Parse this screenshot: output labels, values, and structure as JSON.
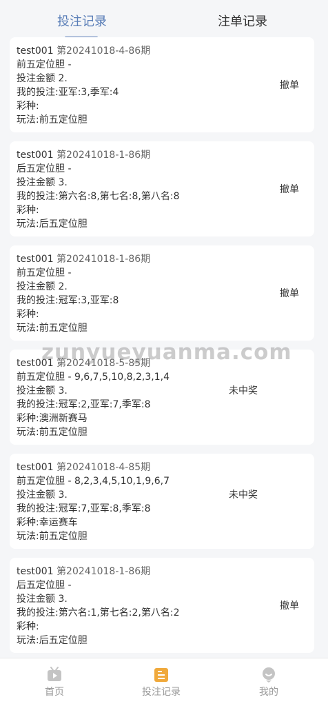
{
  "tabs": {
    "bets": "投注记录",
    "orders": "注单记录"
  },
  "records": [
    {
      "user": "test001",
      "issue": "第20241018-4-86期",
      "numbers_line": "前五定位胆 -",
      "amount": "投注金额 2.",
      "my_bet": "我的投注:亚军:3,季军:4",
      "lottery": "彩种:",
      "play": "玩法:前五定位胆",
      "status": "撤单"
    },
    {
      "user": "test001",
      "issue": "第20241018-1-86期",
      "numbers_line": "后五定位胆 -",
      "amount": "投注金额 3.",
      "my_bet": "我的投注:第六名:8,第七名:8,第八名:8",
      "lottery": "彩种:",
      "play": "玩法:后五定位胆",
      "status": "撤单"
    },
    {
      "user": "test001",
      "issue": "第20241018-1-86期",
      "numbers_line": "前五定位胆 -",
      "amount": "投注金额 2.",
      "my_bet": "我的投注:冠军:3,亚军:8",
      "lottery": "彩种:",
      "play": "玩法:前五定位胆",
      "status": "撤单"
    },
    {
      "user": "test001",
      "issue": "第20241018-5-85期",
      "numbers_line": "前五定位胆 - 9,6,7,5,10,8,2,3,1,4",
      "amount": "投注金额 3.",
      "my_bet": "我的投注:冠军:2,亚军:7,季军:8",
      "lottery": "彩种:澳洲新赛马",
      "play": "玩法:前五定位胆",
      "status": "未中奖"
    },
    {
      "user": "test001",
      "issue": "第20241018-4-85期",
      "numbers_line": "前五定位胆 - 8,2,3,4,5,10,1,9,6,7",
      "amount": "投注金额 3.",
      "my_bet": "我的投注:冠军:7,亚军:8,季军:8",
      "lottery": "彩种:幸运赛车",
      "play": "玩法:前五定位胆",
      "status": "未中奖"
    },
    {
      "user": "test001",
      "issue": "第20241018-1-86期",
      "numbers_line": "后五定位胆 -",
      "amount": "投注金额 3.",
      "my_bet": "我的投注:第六名:1,第七名:2,第八名:2",
      "lottery": "彩种:",
      "play": "玩法:后五定位胆",
      "status": "撤单"
    }
  ],
  "watermark": "zunyueyuanma.com",
  "nav": {
    "home": "首页",
    "bets": "投注记录",
    "mine": "我的"
  },
  "colors": {
    "accent": "#5b7fb8",
    "nav_active": "#f0a93b",
    "nav_inactive": "#c4c4c4"
  }
}
